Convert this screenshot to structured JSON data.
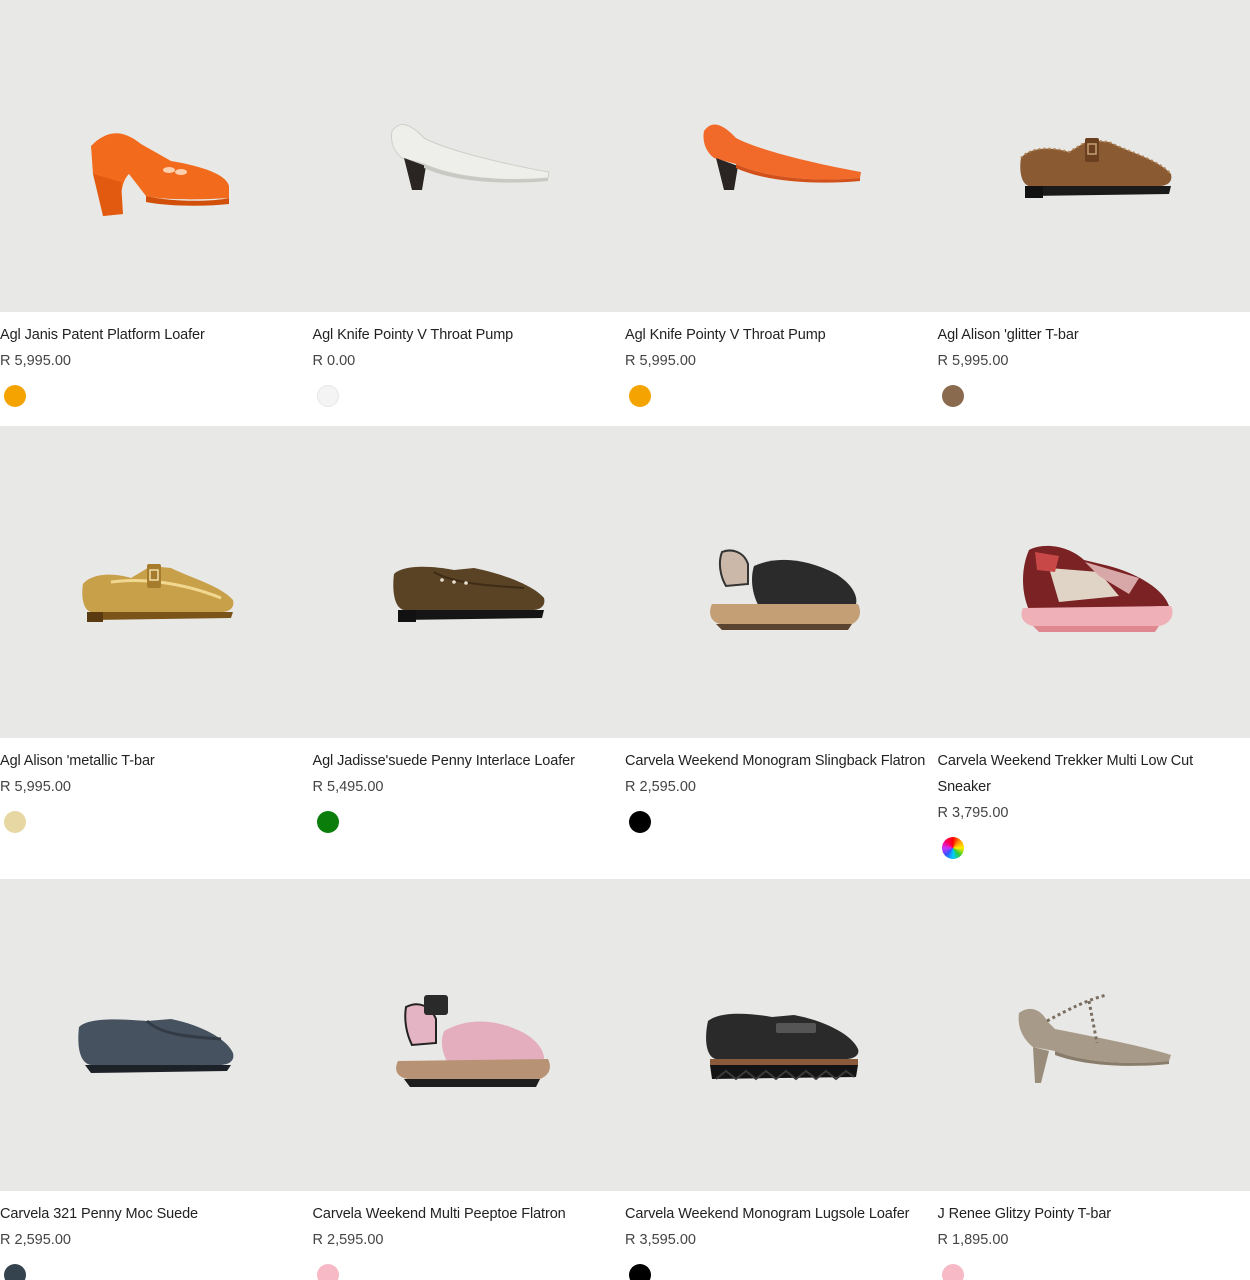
{
  "products": [
    {
      "name": "Agl Janis Patent Platform Loafer",
      "price": "R 5,995.00",
      "swatch_color": "#f5a300",
      "icon": "platform-loafer-icon"
    },
    {
      "name": "Agl Knife Pointy V Throat Pump",
      "price": "R 0.00",
      "swatch_color": "#f4f4f4",
      "icon": "pointy-pump-icon"
    },
    {
      "name": "Agl Knife Pointy V Throat Pump",
      "price": "R 5,995.00",
      "swatch_color": "#f5a300",
      "icon": "pointy-pump-icon"
    },
    {
      "name": "Agl Alison 'glitter T-bar",
      "price": "R 5,995.00",
      "swatch_color": "#8a6a4e",
      "icon": "t-bar-shoe-icon"
    },
    {
      "name": "Agl Alison 'metallic T-bar",
      "price": "R 5,995.00",
      "swatch_color": "#e6d7a3",
      "icon": "t-bar-shoe-icon"
    },
    {
      "name": "Agl Jadisse'suede Penny Interlace Loafer",
      "price": "R 5,495.00",
      "swatch_color": "#0a7d0a",
      "icon": "penny-loafer-icon"
    },
    {
      "name": "Carvela Weekend Monogram Slingback Flatron",
      "price": "R 2,595.00",
      "swatch_color": "#000000",
      "icon": "slingback-sandal-icon"
    },
    {
      "name": "Carvela Weekend Trekker Multi Low Cut Sneaker",
      "price": "R 3,795.00",
      "swatch_color": "multi",
      "icon": "sneaker-icon"
    },
    {
      "name": "Carvela 321 Penny Moc Suede",
      "price": "R 2,595.00",
      "swatch_color": "#35434f",
      "icon": "moccasin-icon"
    },
    {
      "name": "Carvela Weekend Multi Peeptoe Flatron",
      "price": "R 2,595.00",
      "swatch_color": "#f7b9c6",
      "icon": "peeptoe-sandal-icon"
    },
    {
      "name": "Carvela Weekend Monogram Lugsole Loafer",
      "price": "R 3,595.00",
      "swatch_color": "#000000",
      "icon": "lugsole-loafer-icon"
    },
    {
      "name": "J Renee Glitzy Pointy T-bar",
      "price": "R 1,895.00",
      "swatch_color": "#f7b9c6",
      "icon": "pointy-t-bar-heel-icon"
    }
  ]
}
